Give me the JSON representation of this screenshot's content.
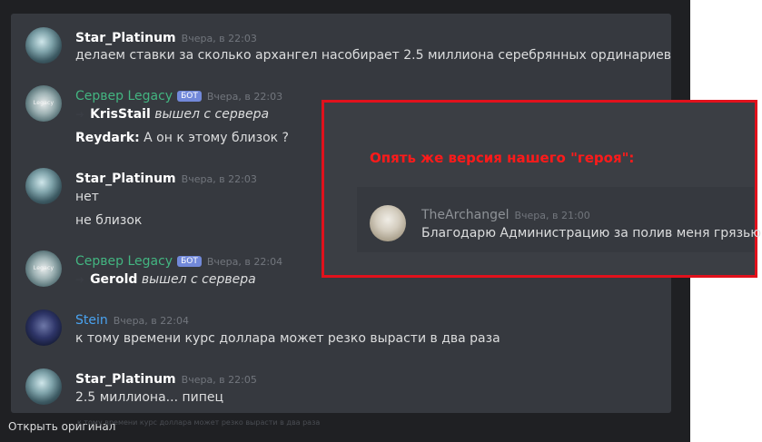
{
  "messages": [
    {
      "avatar_icon": "star-platinum-avatar",
      "user": "Star_Platinum",
      "time": "Вчера, в 22:03",
      "lines": [
        "делаем ставки за сколько архангел насобирает 2.5 миллиона серебрянных ординариев"
      ]
    },
    {
      "avatar_icon": "legacy-server-avatar",
      "avatar_text": "Legacy",
      "user": "Сервер Legacy",
      "bot_tag": "БОТ",
      "time": "Вчера, в 22:03",
      "system": {
        "name": "KrisStail",
        "action": "вышел с сервера"
      },
      "lines": [
        {
          "name": "Reydark:",
          "text": " А он к этому близок ?"
        }
      ]
    },
    {
      "avatar_icon": "star-platinum-avatar",
      "user": "Star_Platinum",
      "time": "Вчера, в 22:03",
      "lines": [
        "нет",
        "не близок"
      ]
    },
    {
      "avatar_icon": "legacy-server-avatar",
      "avatar_text": "Legacy",
      "user": "Сервер Legacy",
      "bot_tag": "БОТ",
      "time": "Вчера, в 22:04",
      "system": {
        "name": "Gerold",
        "action": "вышел с сервера"
      }
    },
    {
      "avatar_icon": "stein-avatar",
      "user": "Stein",
      "time": "Вчера, в 22:04",
      "lines": [
        "к тому времени курс доллара может резко вырасти в два раза"
      ]
    },
    {
      "avatar_icon": "star-platinum-avatar",
      "user": "Star_Platinum",
      "time": "Вчера, в 22:05",
      "lines": [
        "2.5  миллиона... пипец"
      ]
    }
  ],
  "footer": {
    "open_original": "Открыть оригинал",
    "ghost_text": "к тому времени курс доллара может резко вырасти в два раза"
  },
  "annotation": {
    "caption": "Опять же версия нашего \"героя\":",
    "quote": {
      "avatar_icon": "thearchangel-avatar",
      "user": "TheArchangel",
      "time": "Вчера, в 21:00",
      "text": "Благодарю Администрацию за полив меня грязью"
    },
    "border_color": "#e1111c"
  },
  "colors": {
    "chat_bg": "#36393f",
    "username_white": "#ffffff",
    "username_green": "#43b581",
    "username_blue": "#4aa3f0",
    "bot_tag": "#7289da",
    "caption_red": "#ff1a1a"
  }
}
